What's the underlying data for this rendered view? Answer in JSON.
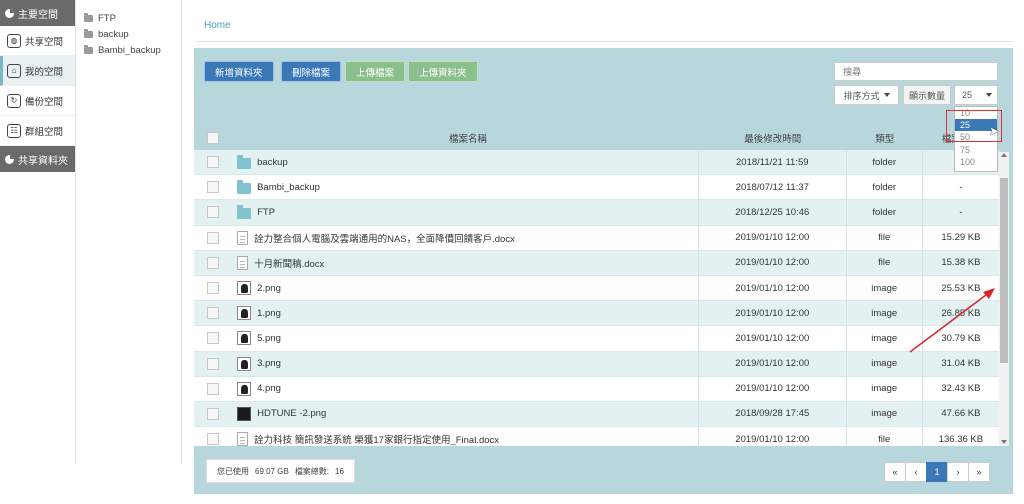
{
  "nav": {
    "header": "主要空間",
    "items": [
      {
        "label": "共享空間",
        "icon": "globe-icon",
        "glyph": "◍"
      },
      {
        "label": "我的空間",
        "icon": "home-icon",
        "glyph": "⌂"
      },
      {
        "label": "備份空間",
        "icon": "backup-icon",
        "glyph": "↻"
      },
      {
        "label": "群組空間",
        "icon": "group-icon",
        "glyph": "☷"
      }
    ],
    "shared_header": "共享資料夾"
  },
  "tree": [
    "FTP",
    "backup",
    "Bambi_backup"
  ],
  "breadcrumb": "Home",
  "toolbar": {
    "new_folder": "新增資料夾",
    "delete_files": "刪除檔案",
    "upload_file": "上傳檔案",
    "upload_folder": "上傳資料夾"
  },
  "search": {
    "placeholder": "搜尋"
  },
  "sort": {
    "label": "排序方式"
  },
  "show_count": {
    "label": "顯示數量",
    "value": "25",
    "options": [
      "10",
      "25",
      "50",
      "75",
      "100"
    ],
    "selected": "25"
  },
  "table": {
    "headers": {
      "name": "檔案名稱",
      "date": "最後修改時間",
      "type": "類型",
      "size": "檔案大小"
    },
    "rows": [
      {
        "icon": "folder",
        "name": "backup",
        "date": "2018/11/21 11:59",
        "type": "folder",
        "size": "-"
      },
      {
        "icon": "folder",
        "name": "Bambi_backup",
        "date": "2018/07/12 11:37",
        "type": "folder",
        "size": "-"
      },
      {
        "icon": "folder",
        "name": "FTP",
        "date": "2018/12/25 10:46",
        "type": "folder",
        "size": "-"
      },
      {
        "icon": "doc",
        "name": "詮力整合個人電腦及雲端通用的NAS，全面降價回饋客戶.docx",
        "date": "2019/01/10 12:00",
        "type": "file",
        "size": "15.29 KB"
      },
      {
        "icon": "doc",
        "name": "十月新聞稿.docx",
        "date": "2019/01/10 12:00",
        "type": "file",
        "size": "15.38 KB"
      },
      {
        "icon": "img",
        "name": "2.png",
        "date": "2019/01/10 12:00",
        "type": "image",
        "size": "25.53 KB"
      },
      {
        "icon": "img",
        "name": "1.png",
        "date": "2019/01/10 12:00",
        "type": "image",
        "size": "26.85 KB"
      },
      {
        "icon": "img",
        "name": "5.png",
        "date": "2019/01/10 12:00",
        "type": "image",
        "size": "30.79 KB"
      },
      {
        "icon": "img",
        "name": "3.png",
        "date": "2019/01/10 12:00",
        "type": "image",
        "size": "31.04 KB"
      },
      {
        "icon": "img",
        "name": "4.png",
        "date": "2019/01/10 12:00",
        "type": "image",
        "size": "32.43 KB"
      },
      {
        "icon": "dark",
        "name": "HDTUNE -2.png",
        "date": "2018/09/28 17:45",
        "type": "image",
        "size": "47.66 KB"
      },
      {
        "icon": "doc",
        "name": "詮力科技 簡訊發送系統 榮獲17家銀行指定使用_Final.docx",
        "date": "2019/01/10 12:00",
        "type": "file",
        "size": "136.36 KB"
      }
    ]
  },
  "footer": {
    "used_label": "您已使用",
    "used_value": "69.07 GB",
    "count_label": "檔案總數:",
    "count_value": "16"
  },
  "pager": {
    "first": "«",
    "prev": "‹",
    "current": "1",
    "next": "›",
    "last": "»"
  },
  "colors": {
    "accent": "#3b78b8",
    "panel": "#b8d7dc",
    "annotation": "#d9252b"
  }
}
